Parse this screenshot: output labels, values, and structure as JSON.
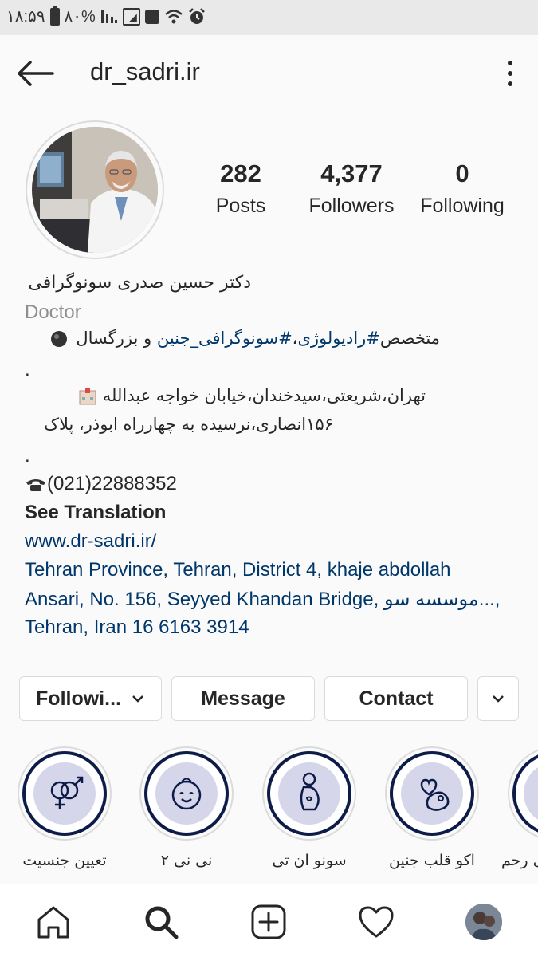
{
  "status_bar": {
    "time": "۱۸:۵۹",
    "battery": "۸۰%"
  },
  "header": {
    "username": "dr_sadri.ir"
  },
  "stats": [
    {
      "value": "282",
      "label": "Posts"
    },
    {
      "value": "4,377",
      "label": "Followers"
    },
    {
      "value": "0",
      "label": "Following"
    }
  ],
  "bio": {
    "name": "دکتر حسین صدری سونوگرافی",
    "category": "Doctor",
    "line1_pre": "متخصص",
    "line1_tag1": "#رادیولوژی",
    "line1_sep": "،",
    "line1_tag2": "#سونوگرافی_جنین",
    "line1_post": " و بزرگسال",
    "dot1": ".",
    "address1": "تهران،شریعتی،سیدخندان،خیابان خواجه عبدالله",
    "address2": "۱۵۶انصاری،نرسیده به چهارراه ابوذر، پلاک",
    "dot2": ".",
    "phone": "(021)22888352",
    "see_translation": "See Translation",
    "website": "www.dr-sadri.ir/",
    "location_line1": "Tehran Province, Tehran, District 4, khaje abdollah",
    "location_line2": "Ansari, No. 156, Seyyed Khandan Bridge, موسسه سو...,",
    "location_line3": "Tehran, Iran 16 6163 3914"
  },
  "buttons": {
    "following": "Followi...",
    "message": "Message",
    "contact": "Contact"
  },
  "highlights": [
    {
      "label": "تعیین جنسیت",
      "icon": "gender-symbols-icon"
    },
    {
      "label": "نی نی ۲",
      "icon": "baby-face-icon"
    },
    {
      "label": "سونو ان تی",
      "icon": "pregnant-woman-icon"
    },
    {
      "label": "اکو قلب جنین",
      "icon": "fetus-heart-icon"
    },
    {
      "label": "ی رحم",
      "icon": "uterus-icon"
    }
  ],
  "colors": {
    "link": "#00376b",
    "highlight_ring": "#0d1b48",
    "highlight_fill": "#d6d6ea"
  }
}
